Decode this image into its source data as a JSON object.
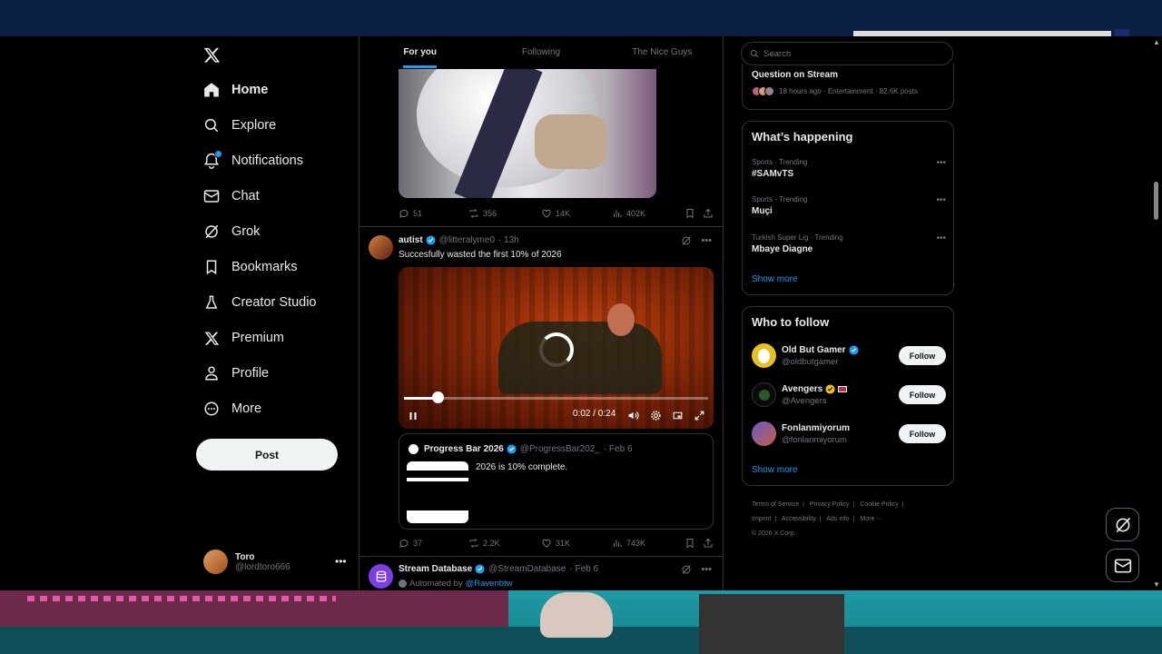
{
  "nav": {
    "items": [
      {
        "label": "Home",
        "icon": "home-icon"
      },
      {
        "label": "Explore",
        "icon": "search-icon"
      },
      {
        "label": "Notifications",
        "icon": "bell-icon"
      },
      {
        "label": "Chat",
        "icon": "mail-icon"
      },
      {
        "label": "Grok",
        "icon": "grok-icon"
      },
      {
        "label": "Bookmarks",
        "icon": "bookmark-icon"
      },
      {
        "label": "Creator Studio",
        "icon": "flask-icon"
      },
      {
        "label": "Premium",
        "icon": "x-logo-icon"
      },
      {
        "label": "Profile",
        "icon": "person-icon"
      },
      {
        "label": "More",
        "icon": "more-circle-icon"
      }
    ],
    "post_label": "Post"
  },
  "account": {
    "name": "Toro",
    "handle": "@lordtoro666"
  },
  "tabs": [
    "For you",
    "Following",
    "The Nice Guys"
  ],
  "tweet1": {
    "replies": "51",
    "reposts": "356",
    "likes": "14K",
    "views": "402K"
  },
  "tweet2": {
    "name": "autist",
    "handle": "@litteralyme0",
    "time": "· 13h",
    "text": "Succesfully wasted the first 10% of 2026",
    "video": {
      "time": "0:02 / 0:24",
      "progress": 0.11
    },
    "quote": {
      "name": "Progress Bar 2026",
      "handle": "@ProgressBar202_",
      "date": "· Feb 6",
      "text": "2026 is 10% complete."
    },
    "replies": "37",
    "reposts": "2.2K",
    "likes": "31K",
    "views": "743K"
  },
  "tweet3": {
    "name": "Stream Database",
    "handle": "@StreamDatabase",
    "date": "· Feb 6",
    "automated_prefix": "Automated by",
    "automated_by": "@Ravenbtw"
  },
  "search": {
    "placeholder": "Search"
  },
  "top_trend": {
    "title": "Question on Stream",
    "meta": "18 hours ago · Entertainment · 82.6K posts"
  },
  "happening": {
    "title": "What’s happening",
    "trends": [
      {
        "meta": "Sports · Trending",
        "topic": "#SAMvTS"
      },
      {
        "meta": "Sports · Trending",
        "topic": "Muçi"
      },
      {
        "meta": "Turkish Super Lig · Trending",
        "topic": "Mbaye Diagne"
      }
    ],
    "show_more": "Show more"
  },
  "who_to_follow": {
    "title": "Who to follow",
    "users": [
      {
        "name": "Old But Gamer",
        "handle": "@oldbutgamer"
      },
      {
        "name": "Avengers",
        "handle": "@Avengers"
      },
      {
        "name": "Fonlanmiyorum",
        "handle": "@fonlanmiyorum"
      }
    ],
    "follow_label": "Follow",
    "show_more": "Show more"
  },
  "footer": {
    "links": [
      "Terms of Service",
      "|",
      "Privacy Policy",
      "|",
      "Cookie Policy",
      "|",
      "Imprint",
      "|",
      "Accessibility",
      "|",
      "Ads info",
      "|",
      "More ···"
    ],
    "copyright": "© 2026 X Corp."
  },
  "colors": {
    "accent": "#1d9bf0",
    "background": "#000000",
    "border": "#2f3336",
    "muted": "#71767b",
    "gold": "#f4c20d"
  }
}
